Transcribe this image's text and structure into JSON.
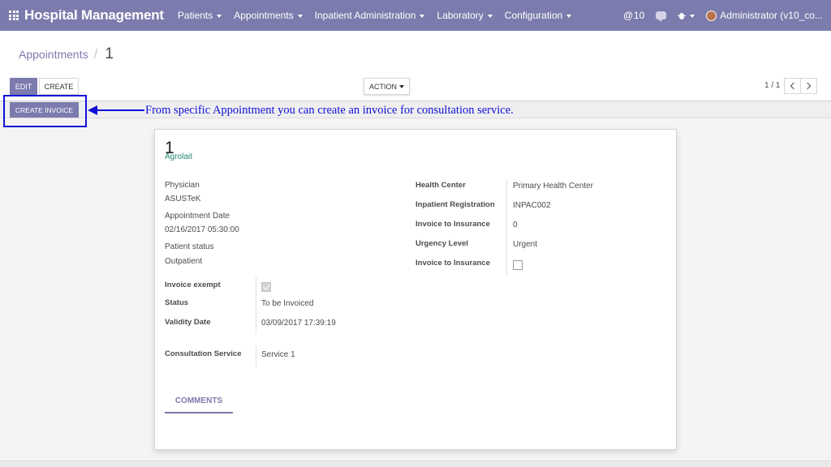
{
  "navbar": {
    "brand": "Hospital Management",
    "menus": [
      "Patients",
      "Appointments",
      "Inpatient Administration",
      "Laboratory",
      "Configuration"
    ],
    "mentions_count": "10",
    "user": "Administrator (v10_co..."
  },
  "breadcrumb": {
    "parent": "Appointments",
    "separator": "/",
    "current": "1"
  },
  "buttons": {
    "edit": "EDIT",
    "create": "CREATE",
    "action": "ACTION",
    "create_invoice": "CREATE INVOICE"
  },
  "pager": {
    "value": "1 / 1"
  },
  "annotation": {
    "text": "From specific Appointment you can create an invoice for consultation service.",
    "color": "#1010d8"
  },
  "record": {
    "name": "1",
    "company": "Agrolait",
    "left": {
      "physician_label": "Physician",
      "physician": "ASUSTeK",
      "date_label": "Appointment Date",
      "date": "02/16/2017 05:30:00",
      "status_label": "Patient status",
      "status": "Outpatient"
    },
    "right": {
      "health_center_label": "Health Center",
      "health_center": "Primary Health Center",
      "inpatient_label": "Inpatient Registration",
      "inpatient": "INPAC002",
      "insurance_label": "Invoice to Insurance",
      "insurance_value": "0",
      "urgency_label": "Urgency Level",
      "urgency": "Urgent",
      "insurance_check_label": "Invoice to Insurance",
      "insurance_checked": false
    },
    "invoice": {
      "exempt_label": "Invoice exempt",
      "exempt_checked": true,
      "status_label": "Status",
      "status": "To be Invoiced",
      "validity_label": "Validity Date",
      "validity": "03/09/2017 17:39:19"
    },
    "consultation": {
      "label": "Consultation Service",
      "value": "Service 1"
    },
    "tabs": [
      "COMMENTS"
    ]
  },
  "colors": {
    "primary": "#7c7bad",
    "link": "#1f8a70"
  }
}
